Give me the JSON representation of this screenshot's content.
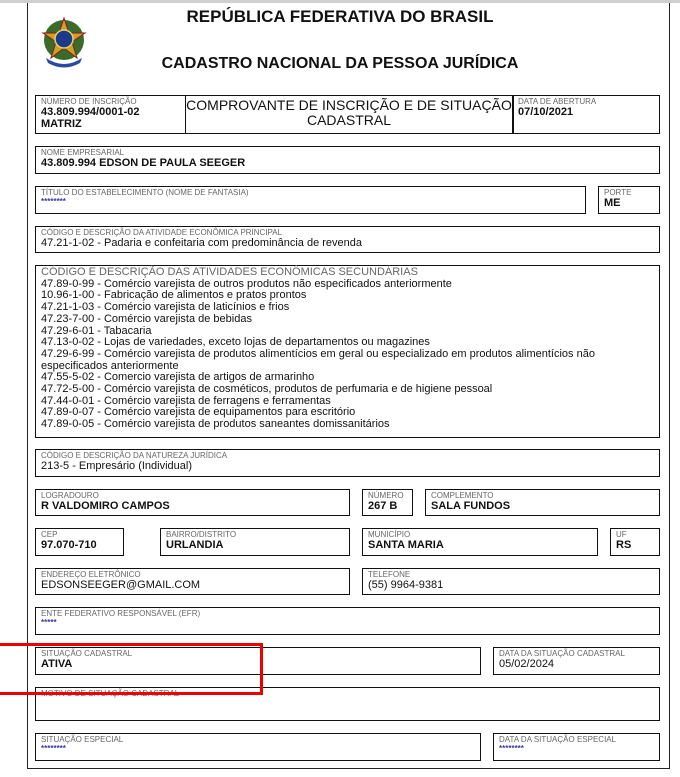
{
  "header": {
    "title": "REPÚBLICA FEDERATIVA DO BRASIL",
    "subtitle": "CADASTRO NACIONAL DA PESSOA JURÍDICA",
    "doc_title": "COMPROVANTE DE INSCRIÇÃO E DE SITUAÇÃO CADASTRAL"
  },
  "fields": {
    "numero_inscricao": {
      "label": "NÚMERO DE INSCRIÇÃO",
      "value": "43.809.994/0001-02",
      "extra": "MATRIZ"
    },
    "data_abertura": {
      "label": "DATA DE ABERTURA",
      "value": "07/10/2021"
    },
    "nome": {
      "label": "NOME EMPRESARIAL",
      "value": "43.809.994 EDSON DE PAULA SEEGER"
    },
    "fantasia": {
      "label": "TÍTULO DO ESTABELECIMENTO (NOME DE FANTASIA)",
      "value": "********"
    },
    "porte": {
      "label": "PORTE",
      "value": "ME"
    },
    "atividade_principal": {
      "label": "CÓDIGO E DESCRIÇÃO DA ATIVIDADE ECONÔMICA PRINCIPAL",
      "value": "47.21-1-02 - Padaria e confeitaria com predominância de revenda"
    },
    "atividades_secundarias": {
      "label": "CÓDIGO E DESCRIÇÃO DAS ATIVIDADES ECONÔMICAS SECUNDÁRIAS",
      "items": [
        "47.89-0-99 - Comércio varejista de outros produtos não especificados anteriormente",
        "10.96-1-00 - Fabricação de alimentos e pratos prontos",
        "47.21-1-03 - Comércio varejista de laticínios e frios",
        "47.23-7-00 - Comércio varejista de bebidas",
        "47.29-6-01 - Tabacaria",
        "47.13-0-02 - Lojas de variedades, exceto lojas de departamentos ou magazines",
        "47.29-6-99 - Comércio varejista de produtos alimentícios em geral ou especializado em produtos alimentícios não especificados anteriormente",
        "47.55-5-02 - Comercio varejista de artigos de armarinho",
        "47.72-5-00 - Comércio varejista de cosméticos, produtos de perfumaria e de higiene pessoal",
        "47.44-0-01 - Comércio varejista de ferragens e ferramentas",
        "47.89-0-07 - Comércio varejista de equipamentos para escritório",
        "47.89-0-05 - Comércio varejista de produtos saneantes domissanitários"
      ]
    },
    "natureza": {
      "label": "CÓDIGO E DESCRIÇÃO DA NATUREZA JURÍDICA",
      "value": "213-5 - Empresário (Individual)"
    },
    "logradouro": {
      "label": "LOGRADOURO",
      "value": "R VALDOMIRO CAMPOS"
    },
    "numero": {
      "label": "NÚMERO",
      "value": "267 B"
    },
    "complemento": {
      "label": "COMPLEMENTO",
      "value": "SALA FUNDOS"
    },
    "cep": {
      "label": "CEP",
      "value": "97.070-710"
    },
    "bairro": {
      "label": "BAIRRO/DISTRITO",
      "value": "URLANDIA"
    },
    "municipio": {
      "label": "MUNICÍPIO",
      "value": "SANTA MARIA"
    },
    "uf": {
      "label": "UF",
      "value": "RS"
    },
    "email": {
      "label": "ENDEREÇO ELETRÔNICO",
      "value": "EDSONSEEGER@GMAIL.COM"
    },
    "telefone": {
      "label": "TELEFONE",
      "value": "(55) 9964-9381"
    },
    "efr": {
      "label": "ENTE FEDERATIVO RESPONSÁVEL (EFR)",
      "value": "*****"
    },
    "situacao": {
      "label": "SITUAÇÃO CADASTRAL",
      "value": "ATIVA"
    },
    "data_situacao": {
      "label": "DATA DA SITUAÇÃO CADASTRAL",
      "value": "05/02/2024"
    },
    "motivo": {
      "label": "MOTIVO DE SITUAÇÃO CADASTRAL",
      "value": ""
    },
    "situacao_especial": {
      "label": "SITUAÇÃO ESPECIAL",
      "value": "********"
    },
    "data_situacao_especial": {
      "label": "DATA DA SITUAÇÃO ESPECIAL",
      "value": "********"
    }
  },
  "colors": {
    "highlight": "#e00000",
    "masked_text": "#3a3aa0"
  }
}
